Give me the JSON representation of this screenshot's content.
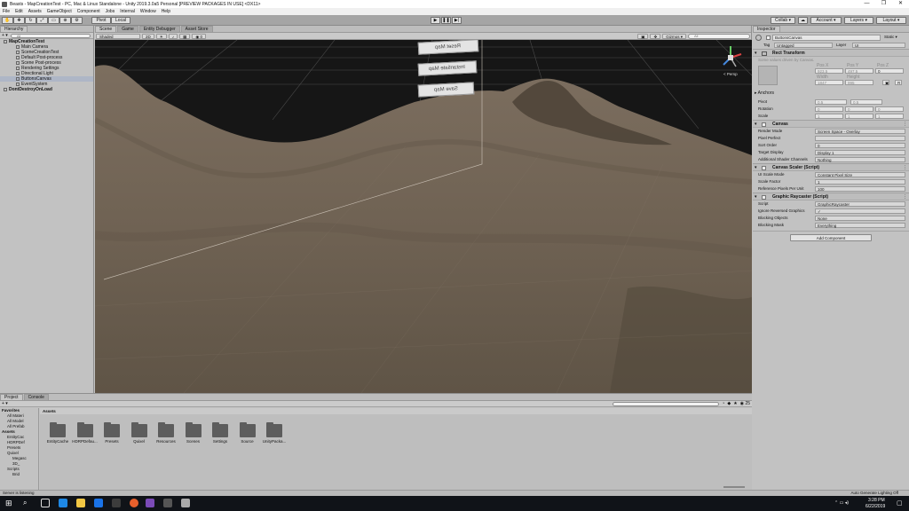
{
  "window": {
    "title": "Beasts - MapCreationTest - PC, Mac & Linux Standalone - Unity 2019.3.0a5 Personal [PREVIEW PACKAGES IN USE] <DX11>",
    "min": "—",
    "max": "❐",
    "close": "✕"
  },
  "menu": [
    "File",
    "Edit",
    "Assets",
    "GameObject",
    "Component",
    "Jobs",
    "Internal",
    "Window",
    "Help"
  ],
  "toolbar": {
    "pivot": "Pivot",
    "local": "Local",
    "collab": "Collab ▾",
    "account": "Account ▾",
    "layers": "Layers ▾",
    "layout": "Layout ▾",
    "play": "▶",
    "pause": "❚❚",
    "step": "▶|"
  },
  "hierarchy": {
    "tab": "Hierarchy",
    "create": "+ ▾",
    "search_placeholder": "All",
    "items": [
      {
        "label": "MapCreationTest",
        "indent": 0,
        "scene": true
      },
      {
        "label": "Main Camera",
        "indent": 1
      },
      {
        "label": "SceneCreationTest",
        "indent": 1
      },
      {
        "label": "Default Post-process",
        "indent": 1
      },
      {
        "label": "Scene Post-process",
        "indent": 1
      },
      {
        "label": "Rendering Settings",
        "indent": 1
      },
      {
        "label": "Directional Light",
        "indent": 1
      },
      {
        "label": "ButtonsCanvas",
        "indent": 1,
        "selected": true
      },
      {
        "label": "EventSystem",
        "indent": 1
      },
      {
        "label": "DontDestroyOnLoad",
        "indent": 0,
        "scene": true
      }
    ]
  },
  "scene": {
    "tabs": [
      "Scene",
      "Game",
      "Entity Debugger",
      "Asset Store"
    ],
    "shading": "Shaded",
    "mode2d": "2D",
    "gizmos": "Gizmos ▾",
    "search_placeholder": "All",
    "persp": "< Persp",
    "buttons": [
      "Reset Map",
      "Instantiate Map",
      "Save Map"
    ]
  },
  "inspector": {
    "tab": "Inspector",
    "object_name": "ButtonsCanvas",
    "static": "Static ▾",
    "tag_label": "Tag",
    "tag": "Untagged",
    "layer_label": "Layer",
    "layer": "UI",
    "rect": {
      "title": "Rect Transform",
      "note": "Some values driven by Canvas.",
      "heads1": [
        "Pos X",
        "Pos Y",
        "Pos Z"
      ],
      "vals1": [
        "923.5",
        "497.5",
        "0"
      ],
      "heads2": [
        "Width",
        "Height"
      ],
      "vals2": [
        "1847",
        "995"
      ],
      "anchors": "Anchors",
      "pivot_label": "Pivot",
      "pivot": [
        "0.5",
        "0.5"
      ],
      "rotation_label": "Rotation",
      "rotation": [
        "0",
        "0",
        "0"
      ],
      "scale_label": "Scale",
      "scale": [
        "1",
        "1",
        "1"
      ],
      "r": "R"
    },
    "canvas": {
      "title": "Canvas",
      "rows": [
        {
          "label": "Render Mode",
          "value": "Screen Space - Overlay"
        },
        {
          "label": "Pixel Perfect",
          "value": ""
        },
        {
          "label": "Sort Order",
          "value": "0"
        },
        {
          "label": "Target Display",
          "value": "Display 1"
        },
        {
          "label": "Additional Shader Channels",
          "value": "Nothing"
        }
      ]
    },
    "scaler": {
      "title": "Canvas Scaler (Script)",
      "rows": [
        {
          "label": "UI Scale Mode",
          "value": "Constant Pixel Size"
        },
        {
          "label": "Scale Factor",
          "value": "1"
        },
        {
          "label": "Reference Pixels Per Unit",
          "value": "100"
        }
      ]
    },
    "raycaster": {
      "title": "Graphic Raycaster (Script)",
      "rows": [
        {
          "label": "Script",
          "value": "GraphicRaycaster"
        },
        {
          "label": "Ignore Reversed Graphics",
          "value": "✓"
        },
        {
          "label": "Blocking Objects",
          "value": "None"
        },
        {
          "label": "Blocking Mask",
          "value": "Everything"
        }
      ]
    },
    "add_component": "Add Component"
  },
  "project": {
    "tabs": [
      "Project",
      "Console"
    ],
    "create": "+ ▾",
    "count": "25",
    "tree": [
      "Favorites",
      "All Materi",
      "All Model",
      "All Prefab",
      "Assets",
      "EntityCac",
      "HDRPDef",
      "Presets",
      "Quixel",
      "Megasc",
      "3D_",
      "Scripts",
      "Brid"
    ],
    "breadcrumb": "Assets",
    "assets": [
      "EntityCache",
      "HDRPDefau...",
      "Presets",
      "Quixel",
      "Resources",
      "Scenes",
      "Settings",
      "Source",
      "UnityPacka..."
    ]
  },
  "status": {
    "left": "Server is listening",
    "right": "Auto Generate Lighting Off"
  },
  "taskbar": {
    "time": "3:28 PM",
    "date": "6/22/2019"
  }
}
